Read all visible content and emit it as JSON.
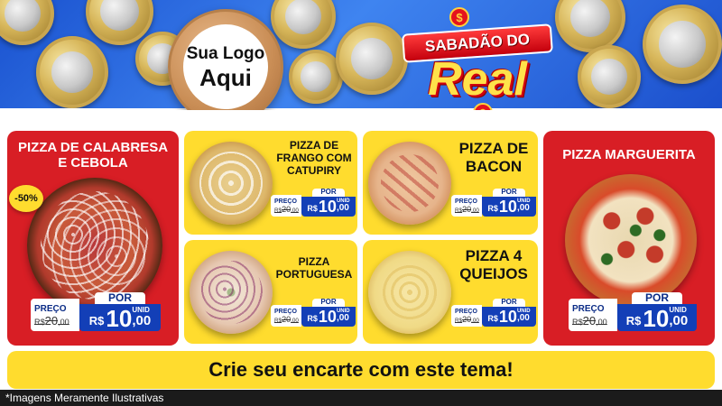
{
  "header": {
    "logo_line1": "Sua Logo",
    "logo_line2": "Aqui",
    "promo_ribbon": "SABADÃO DO",
    "promo_word": "Real",
    "dollar_symbol": "$"
  },
  "products": {
    "calabresa": {
      "title": "PIZZA DE CALABRESA E CEBOLA",
      "discount": "-50%",
      "price_label": "PREÇO",
      "old_price_prefix": "R$",
      "old_price_int": "20",
      "old_price_dec": ",00",
      "new_label": "POR",
      "currency": "R$",
      "new_int": "10",
      "new_dec": ",00",
      "unit": "UNID"
    },
    "frango": {
      "title": "PIZZA DE FRANGO COM CATUPIRY",
      "price_label": "PREÇO",
      "old_price_prefix": "R$",
      "old_price_int": "20",
      "old_price_dec": ",00",
      "new_label": "POR",
      "currency": "R$",
      "new_int": "10",
      "new_dec": ",00",
      "unit": "UNID"
    },
    "bacon": {
      "title": "PIZZA DE BACON",
      "price_label": "PREÇO",
      "old_price_prefix": "R$",
      "old_price_int": "20",
      "old_price_dec": ",00",
      "new_label": "POR",
      "currency": "R$",
      "new_int": "10",
      "new_dec": ",00",
      "unit": "UNID"
    },
    "marguerita": {
      "title": "PIZZA MARGUERITA",
      "price_label": "PREÇO",
      "old_price_prefix": "R$",
      "old_price_int": "20",
      "old_price_dec": ",00",
      "new_label": "POR",
      "currency": "R$",
      "new_int": "10",
      "new_dec": ",00",
      "unit": "UNID"
    },
    "portuguesa": {
      "title": "PIZZA PORTUGUESA",
      "price_label": "PREÇO",
      "old_price_prefix": "R$",
      "old_price_int": "20",
      "old_price_dec": ",00",
      "new_label": "POR",
      "currency": "R$",
      "new_int": "10",
      "new_dec": ",00",
      "unit": "UNID"
    },
    "queijos": {
      "title": "PIZZA 4 QUEIJOS",
      "price_label": "PREÇO",
      "old_price_prefix": "R$",
      "old_price_int": "20",
      "old_price_dec": ",00",
      "new_label": "POR",
      "currency": "R$",
      "new_int": "10",
      "new_dec": ",00",
      "unit": "UNID"
    }
  },
  "banner": {
    "text": "Crie seu encarte com este tema!"
  },
  "footer": {
    "text": "*Imagens Meramente Ilustrativas"
  },
  "colors": {
    "header_blue": "#1f5bd8",
    "card_red": "#d81e25",
    "card_yellow": "#ffdc2e",
    "price_blue": "#133fb7"
  }
}
